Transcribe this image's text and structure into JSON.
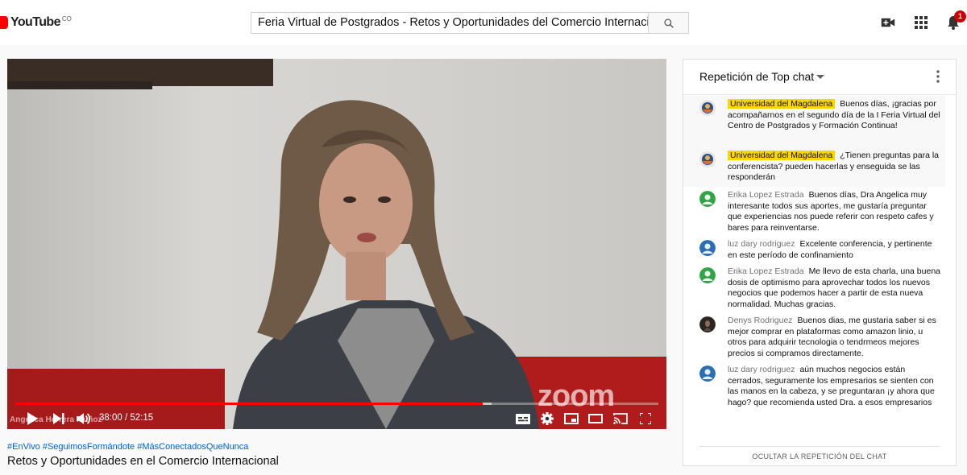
{
  "header": {
    "logo_text": "YouTube",
    "logo_country": "CO",
    "search_value": "Feria Virtual de Postgrados - Retos y Oportunidades del Comercio Internacional",
    "search_icon": "search-icon",
    "notification_count": "1"
  },
  "player": {
    "watermark": "zoom",
    "speaker_label": "Angelica Herrera Muñoz",
    "time_display": "38:00 / 52:15",
    "progress": 0.727,
    "buffered": 0.74
  },
  "video_info": {
    "hashtags": "#EnVivo #SeguimosFormándote #MásConectadosQueNunca",
    "title": "Retos y Oportunidades en el Comercio Internacional"
  },
  "chat": {
    "header_label": "Repetición de Top chat",
    "messages": [
      {
        "author": "Universidad del Magdalena",
        "owner": true,
        "text": "Buenos días, ¡gracias por acompañarnos en el segundo día de la I Feria Virtual del Centro de Postgrados y Formación Continua!"
      },
      {
        "author": "Universidad del Magdalena",
        "owner": true,
        "text": "¿Tienen preguntas para la conferencista? pueden hacerlas y enseguida se las responderán"
      },
      {
        "author": "Erika Lopez Estrada",
        "owner": false,
        "text": "Buenos días, Dra Angelica muy interesante todos sus aportes, me gustaría preguntar que experiencias nos puede referir con respeto cafes y bares para reinventarse."
      },
      {
        "author": "luz dary rodriguez",
        "owner": false,
        "text": "Excelente conferencia, y pertinente en este período de confinamiento"
      },
      {
        "author": "Erika Lopez Estrada",
        "owner": false,
        "text": "Me llevo de esta charla, una buena dosis de optimismo para aprovechar todos los nuevos negocios que podemos hacer a partir de esta nueva normalidad. Muchas gracias."
      },
      {
        "author": "Denys Rodriguez",
        "owner": false,
        "text": "Buenos dias, me gustaria saber si es mejor comprar en plataformas como amazon linio, u otros para adquirir tecnologia o tendrmeos mejores precios si compramos directamente."
      },
      {
        "author": "luz dary rodriguez",
        "owner": false,
        "text": "aún muchos negocios están cerrados, seguramente los empresarios se sienten con las manos en la cabeza, y se preguntaran ¡y ahora que hago? que recomienda usted Dra. a esos empresarios"
      }
    ],
    "footer_label": "OCULTAR LA REPETICIÓN DEL CHAT"
  },
  "colors": {
    "brand_red": "#ff0000",
    "owner_badge": "#ffd600",
    "link_blue": "#065fd4"
  }
}
